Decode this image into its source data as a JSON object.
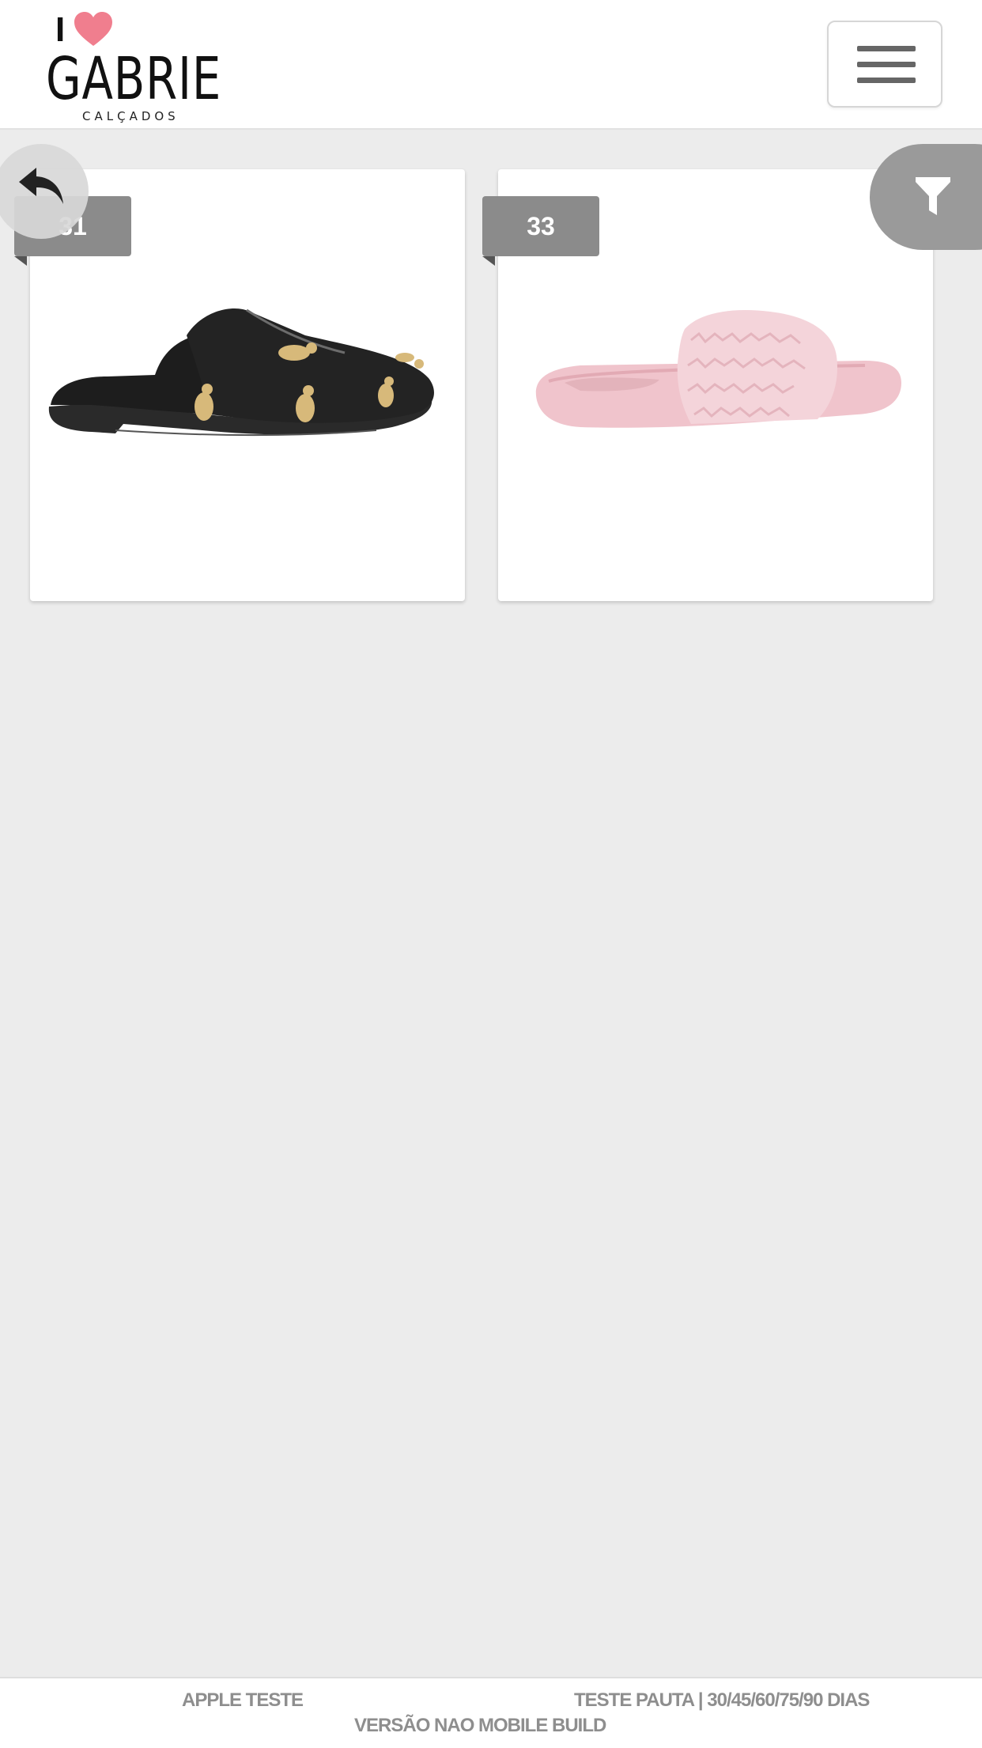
{
  "brand": {
    "logo_top": "I",
    "logo_word": "GABRIE",
    "logo_sub": "CALÇADOS",
    "heart_color": "#f07e8e"
  },
  "header": {
    "menu_icon": "hamburger-icon"
  },
  "actions": {
    "back_icon": "undo-arrow-icon",
    "filter_icon": "filter-funnel-icon"
  },
  "products": [
    {
      "size": "31",
      "image": "black slipper mule with leopard embroidery"
    },
    {
      "size": "33",
      "image": "pink fluffy slide sandal"
    }
  ],
  "footer": {
    "left": "APPLE TESTE",
    "right": "TESTE PAUTA | 30/45/60/75/90 DIAS",
    "center": "VERSÃO NAO MOBILE BUILD"
  }
}
